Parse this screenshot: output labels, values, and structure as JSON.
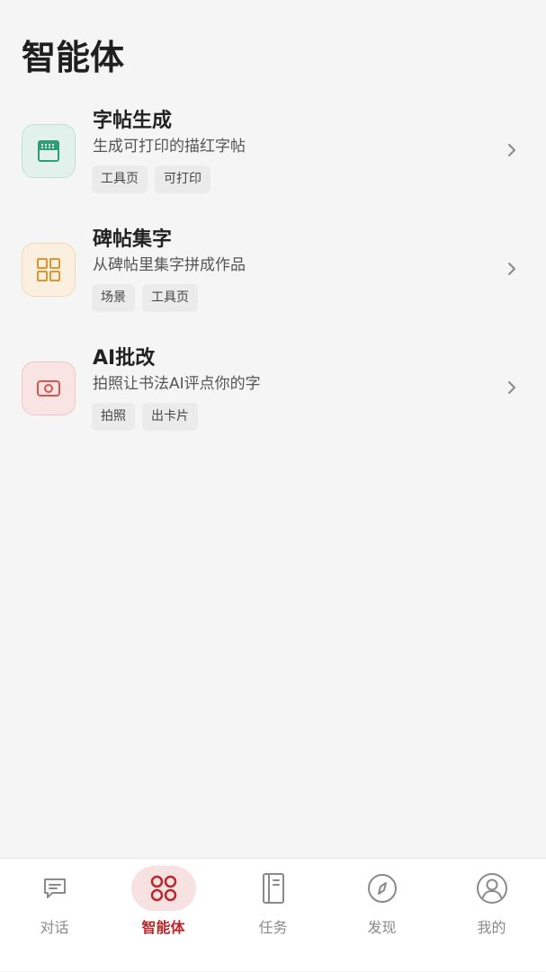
{
  "page": {
    "title": "智能体"
  },
  "agents": [
    {
      "name": "字帖生成",
      "description": "生成可打印的描红字帖",
      "tags": [
        "工具页",
        "可打印"
      ],
      "icon": "copybook-icon",
      "color": "#2e9d78"
    },
    {
      "name": "碑帖集字",
      "description": "从碑帖里集字拼成作品",
      "tags": [
        "场景",
        "工具页"
      ],
      "icon": "grid-icon",
      "color": "#e0952f"
    },
    {
      "name": "AI批改",
      "description": "拍照让书法AI评点你的字",
      "tags": [
        "拍照",
        "出卡片"
      ],
      "icon": "camera-icon",
      "color": "#d9534f"
    }
  ],
  "tabbar": {
    "active": "智能体",
    "active_color": "#b8282c",
    "tabs": [
      {
        "label": "对话",
        "icon": "chat-icon"
      },
      {
        "label": "智能体",
        "icon": "agents-icon"
      },
      {
        "label": "任务",
        "icon": "task-book-icon"
      },
      {
        "label": "发现",
        "icon": "compass-icon"
      },
      {
        "label": "我的",
        "icon": "profile-icon"
      }
    ]
  }
}
